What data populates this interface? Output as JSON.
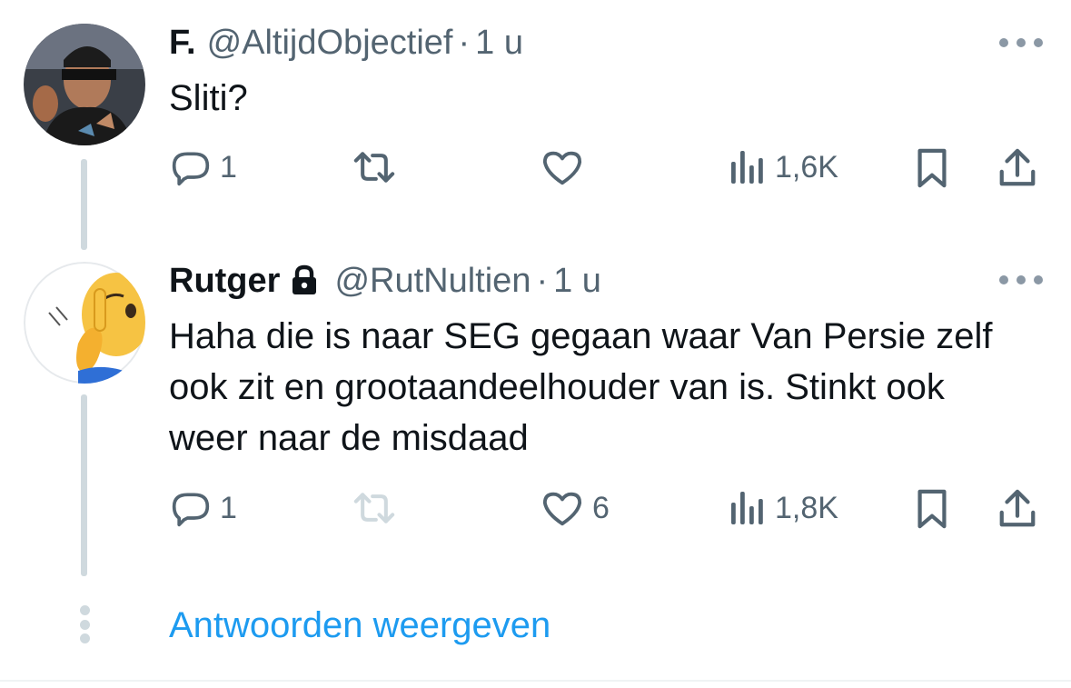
{
  "tweets": [
    {
      "name": "F.",
      "handle": "@AltijdObjectief",
      "separator": "·",
      "time": "1 u",
      "text": "Sliti?",
      "replies": "1",
      "retweets": "",
      "likes": "",
      "views": "1,6K",
      "locked": false
    },
    {
      "name": "Rutger",
      "handle": "@RutNultien",
      "separator": "·",
      "time": "1 u",
      "text": "Haha die is naar SEG gegaan waar Van Persie zelf ook zit en grootaandeelhouder van is. Stinkt ook weer naar de misdaad",
      "replies": "1",
      "retweets": "",
      "likes": "6",
      "views": "1,8K",
      "locked": true
    }
  ],
  "show_replies_label": "Antwoorden weergeven",
  "colors": {
    "text": "#0f1419",
    "secondary": "#536471",
    "link": "#1d9bf0",
    "thread_line": "#cfd9de",
    "disabled_icon": "#cfd9de"
  }
}
